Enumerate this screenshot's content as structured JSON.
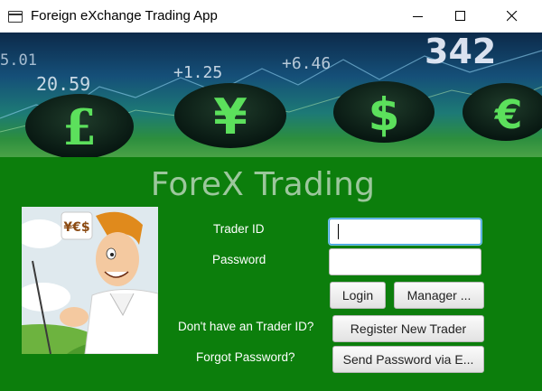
{
  "window": {
    "title": "Foreign eXchange Trading App",
    "icon": "app-window-icon",
    "controls": [
      "minimize-icon",
      "maximize-icon",
      "close-icon"
    ]
  },
  "banner": {
    "ticker_numbers": [
      "5.01",
      "+1.25",
      "20.59",
      "+6.46",
      "342"
    ],
    "currency_symbols": [
      "£",
      "¥",
      "$",
      "€"
    ]
  },
  "heading": "ForeX Trading",
  "illustration": {
    "sign_text": "¥€$"
  },
  "login_form": {
    "trader_id_label": "Trader ID",
    "trader_id_value": "",
    "password_label": "Password",
    "password_value": "",
    "login_button": "Login",
    "manager_button": "Manager ..."
  },
  "register": {
    "prompt": "Don't have an Trader ID?",
    "button": "Register New Trader"
  },
  "forgot": {
    "prompt": "Forgot Password?",
    "button": "Send Password via E..."
  },
  "colors": {
    "panel_green": "#0c7e0c",
    "heading_text": "#9cc79c",
    "focus_blue": "#3aa0d8"
  }
}
